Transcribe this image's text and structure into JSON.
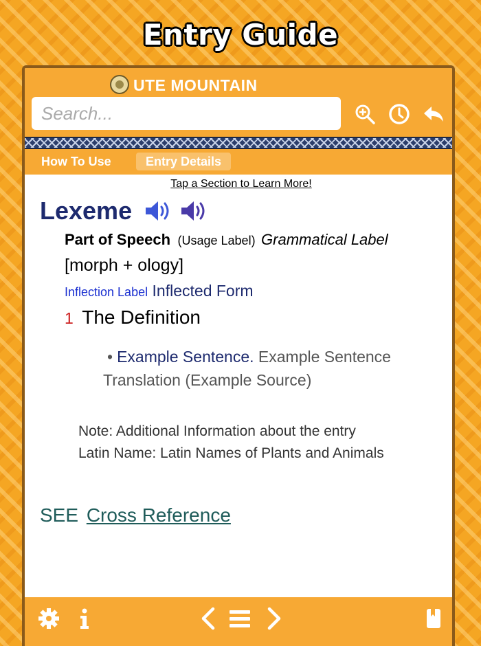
{
  "page_title": "Entry Guide",
  "header": {
    "brand": "UTE MOUNTAIN",
    "search_placeholder": "Search...",
    "tabs": [
      {
        "label": "How To Use",
        "active": false
      },
      {
        "label": "Entry Details",
        "active": true
      }
    ],
    "icons": [
      "zoom-in-icon",
      "history-icon",
      "back-icon"
    ]
  },
  "entry": {
    "hint": "Tap a Section to Learn More!",
    "lexeme": "Lexeme",
    "part_of_speech": "Part of Speech",
    "usage_label": "(Usage Label)",
    "grammatical_label": "Grammatical Label",
    "morphology": "[morph + ology]",
    "inflection_label": "Inflection Label",
    "inflected_form": "Inflected Form",
    "definition_number": "1",
    "definition": "The Definition",
    "example_bullet": "•",
    "example_sentence": "Example Sentence.",
    "example_translation": "Example Sentence Translation (Example Source)",
    "note": "Note: Additional Information about the entry",
    "latin_name": "Latin Name: Latin Names of Plants and Animals",
    "see_prefix": "SEE",
    "cross_reference": "Cross Reference"
  },
  "footer": {
    "icons": [
      "settings-icon",
      "info-icon",
      "previous-icon",
      "menu-icon",
      "next-icon",
      "bookmark-icon"
    ]
  },
  "colors": {
    "accent_orange": "#f7a934",
    "lexeme_navy": "#1d2a6e",
    "speaker_blue": "#3d57d8",
    "speaker_purple": "#4a3aa8",
    "definition_number_red": "#cc1f1f",
    "cross_reference_teal": "#1f5c5a"
  }
}
